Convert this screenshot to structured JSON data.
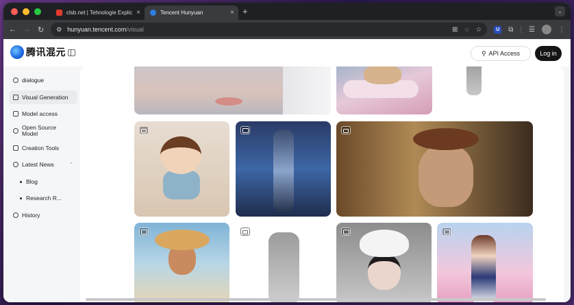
{
  "browser": {
    "tabs": [
      {
        "title": "clsb.net | Tehnologie Explicată",
        "active": false,
        "favicon_color": "#e03b2f"
      },
      {
        "title": "Tencent Hunyuan",
        "active": true,
        "favicon_color": "#2f7de0"
      }
    ],
    "url_host": "hunyuan.tencent.com",
    "url_path": "/visual",
    "traffic_colors": [
      "#ff5f57",
      "#febc2e",
      "#28c840"
    ]
  },
  "header": {
    "logo_text": "腾讯混元",
    "api_label": "API Access",
    "login_label": "Log in"
  },
  "sidebar": {
    "items": [
      {
        "label": "dialogue",
        "icon": "chat-icon"
      },
      {
        "label": "Visual Generation",
        "icon": "image-icon",
        "active": true
      },
      {
        "label": "Model access",
        "icon": "grid-icon"
      },
      {
        "label": "Open Source Model",
        "icon": "open-source-icon"
      },
      {
        "label": "Creation Tools",
        "icon": "tools-icon"
      },
      {
        "label": "Latest News",
        "icon": "sparkle-icon",
        "expanded": true
      },
      {
        "label": "History",
        "icon": "history-icon"
      }
    ],
    "sub_items": [
      "Blog",
      "Research R..."
    ]
  },
  "gallery": {
    "cards": [
      {
        "type": "image",
        "subject": "portrait-closeup"
      },
      {
        "type": "image",
        "subject": "cat-on-cloud"
      },
      {
        "type": "3d",
        "subject": "walking-figure"
      },
      {
        "type": "video",
        "subject": "felt-doll"
      },
      {
        "type": "image",
        "subject": "cyber-robot"
      },
      {
        "type": "video",
        "subject": "old-man-beret"
      },
      {
        "type": "image",
        "subject": "girl-sunhat"
      },
      {
        "type": "video",
        "subject": "robot-figure"
      },
      {
        "type": "image",
        "subject": "girl-white-hat"
      },
      {
        "type": "image",
        "subject": "anime-girl-sakura"
      }
    ]
  }
}
